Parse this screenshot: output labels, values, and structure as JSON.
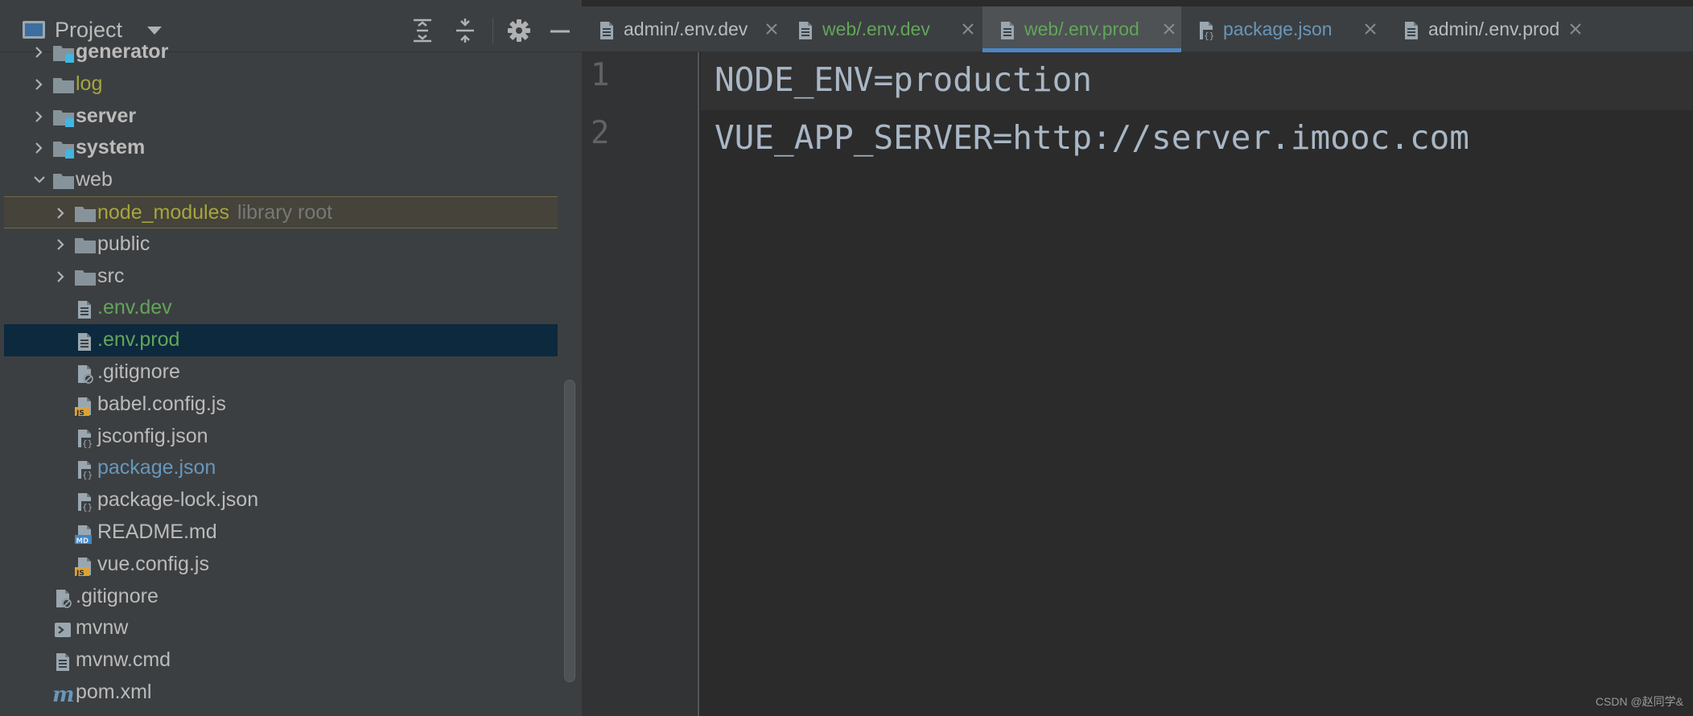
{
  "project_panel": {
    "title": "Project",
    "header_buttons": [
      "expand-all-icon",
      "collapse-all-icon",
      "gear-icon",
      "hide-icon"
    ]
  },
  "tree": {
    "items": [
      {
        "label": "generator",
        "style": "bold",
        "icon": "module-folder-icon",
        "chevron": "right",
        "indent": 0
      },
      {
        "label": "log",
        "style": "olive",
        "icon": "folder-icon",
        "chevron": "right",
        "indent": 0
      },
      {
        "label": "server",
        "style": "bold",
        "icon": "module-folder-icon",
        "chevron": "right",
        "indent": 0
      },
      {
        "label": "system",
        "style": "bold",
        "icon": "module-folder-icon",
        "chevron": "right",
        "indent": 0
      },
      {
        "label": "web",
        "style": "plain",
        "icon": "folder-icon",
        "chevron": "down",
        "indent": 0
      },
      {
        "label": "node_modules",
        "extra": "library root",
        "style": "olive",
        "icon": "folder-icon",
        "chevron": "right",
        "indent": 1
      },
      {
        "label": "public",
        "style": "plain",
        "icon": "folder-icon",
        "chevron": "right",
        "indent": 1
      },
      {
        "label": "src",
        "style": "plain",
        "icon": "folder-icon",
        "chevron": "right",
        "indent": 1
      },
      {
        "label": ".env.dev",
        "style": "green",
        "icon": "text-file-icon",
        "indent": 1
      },
      {
        "label": ".env.prod",
        "style": "green",
        "icon": "text-file-icon",
        "indent": 1
      },
      {
        "label": ".gitignore",
        "style": "plain",
        "icon": "ignore-file-icon",
        "indent": 1
      },
      {
        "label": "babel.config.js",
        "style": "plain",
        "icon": "js-file-icon",
        "indent": 1
      },
      {
        "label": "jsconfig.json",
        "style": "plain",
        "icon": "json-file-icon",
        "indent": 1
      },
      {
        "label": "package.json",
        "style": "blue",
        "icon": "json-file-icon",
        "indent": 1
      },
      {
        "label": "package-lock.json",
        "style": "plain",
        "icon": "json-file-icon",
        "indent": 1
      },
      {
        "label": "README.md",
        "style": "plain",
        "icon": "md-file-icon",
        "indent": 1
      },
      {
        "label": "vue.config.js",
        "style": "plain",
        "icon": "js-file-icon",
        "indent": 1
      },
      {
        "label": ".gitignore",
        "style": "plain",
        "icon": "ignore-file-icon",
        "indent": 0
      },
      {
        "label": "mvnw",
        "style": "plain",
        "icon": "shell-file-icon",
        "indent": 0
      },
      {
        "label": "mvnw.cmd",
        "style": "plain",
        "icon": "text-file-icon",
        "indent": 0
      },
      {
        "label": "pom.xml",
        "style": "plain",
        "icon": "maven-icon",
        "indent": 0
      }
    ],
    "selected": ".env.prod",
    "library_root_item": "node_modules"
  },
  "tabs": [
    {
      "label": "admin/.env.dev",
      "style": "plain",
      "icon": "text-file-icon",
      "active": false
    },
    {
      "label": "web/.env.dev",
      "style": "green",
      "icon": "text-file-icon",
      "active": false
    },
    {
      "label": "web/.env.prod",
      "style": "green",
      "icon": "text-file-icon",
      "active": true
    },
    {
      "label": "package.json",
      "style": "blue",
      "icon": "json-file-icon",
      "active": false
    },
    {
      "label": "admin/.env.prod",
      "style": "plain",
      "icon": "text-file-icon",
      "active": false
    }
  ],
  "editor": {
    "lines": [
      {
        "number": "1",
        "text": "NODE_ENV=production"
      },
      {
        "number": "2",
        "text": "VUE_APP_SERVER=http://server.imooc.com"
      }
    ]
  },
  "watermark": "CSDN @赵同学&",
  "colors": {
    "accent": "#4a88c7",
    "vcs_green": "#62a55a",
    "vcs_blue": "#6897bb",
    "ignored_olive": "#a8a53e",
    "selection": "#0d293e"
  }
}
